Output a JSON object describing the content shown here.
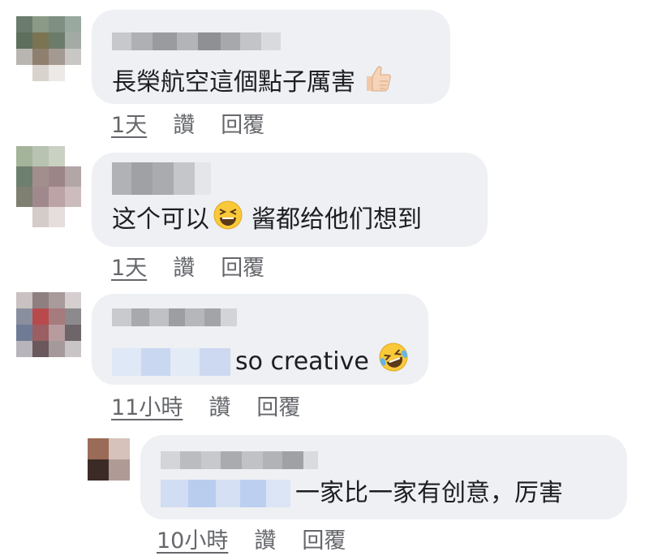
{
  "comments": [
    {
      "text": "長榮航空這個點子厲害",
      "emoji": "thumbs-up-icon",
      "time": "1天",
      "like": "讚",
      "reply": "回覆"
    },
    {
      "text": "这个可以",
      "emoji": "grinning-squinting-face-icon",
      "text2": "酱都给他们想到",
      "time": "1天",
      "like": "讚",
      "reply": "回覆"
    },
    {
      "text": "so creative",
      "emoji": "rolling-on-floor-laughing-icon",
      "time": "11小時",
      "like": "讚",
      "reply": "回覆"
    },
    {
      "text": "一家比一家有创意，厉害",
      "time": "10小時",
      "like": "讚",
      "reply": "回覆"
    }
  ]
}
